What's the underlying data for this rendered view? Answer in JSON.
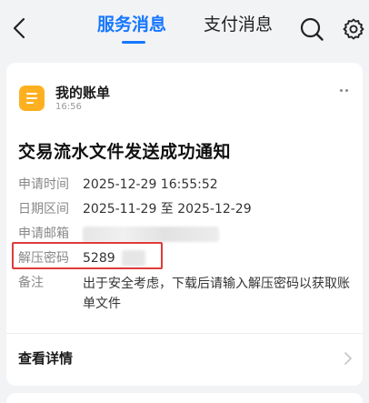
{
  "header": {
    "tabs": [
      {
        "label": "服务消息",
        "active": true
      },
      {
        "label": "支付消息",
        "active": false
      }
    ],
    "icons": {
      "back": "back-arrow-icon",
      "search": "search-icon",
      "settings": "gear-icon"
    },
    "accent_color": "#1677ff"
  },
  "message": {
    "sender": "我的账单",
    "time": "16:56",
    "title": "交易流水文件发送成功通知",
    "fields": [
      {
        "label": "申请时间",
        "value": "2025-12-29 16:55:52"
      },
      {
        "label": "日期区间",
        "value": "2025-11-29 至 2025-12-29"
      },
      {
        "label": "申请邮箱",
        "value": ""
      },
      {
        "label": "解压密码",
        "value": "5289"
      },
      {
        "label": "备注",
        "value": "出于安全考虑，下载后请输入解压密码以获取账单文件"
      }
    ],
    "detail_link": "查看详情",
    "highlight_color": "#e03a3a",
    "icon_color": "#ffb020"
  }
}
